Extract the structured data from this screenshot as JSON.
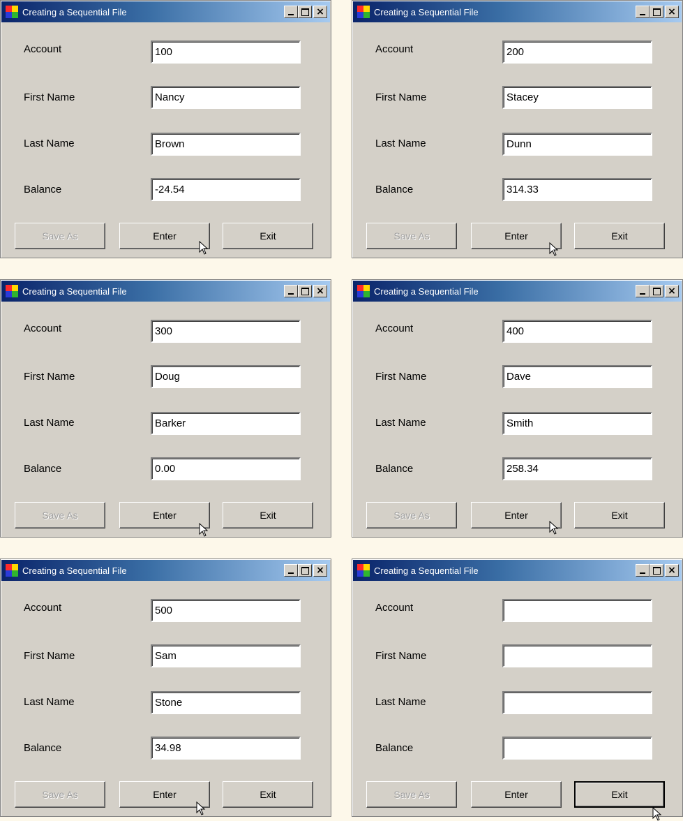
{
  "labels": {
    "account": "Account",
    "first_name": "First Name",
    "last_name": "Last Name",
    "balance": "Balance"
  },
  "buttons": {
    "save_as": "Save As",
    "enter": "Enter",
    "exit": "Exit"
  },
  "window_title": "Creating a Sequential File",
  "windows": [
    {
      "account": "100",
      "first_name": "Nancy",
      "last_name": "Brown",
      "balance": "-24.54"
    },
    {
      "account": "200",
      "first_name": "Stacey",
      "last_name": "Dunn",
      "balance": "314.33"
    },
    {
      "account": "300",
      "first_name": "Doug",
      "last_name": "Barker",
      "balance": "0.00"
    },
    {
      "account": "400",
      "first_name": "Dave",
      "last_name": "Smith",
      "balance": "258.34"
    },
    {
      "account": "500",
      "first_name": "Sam",
      "last_name": "Stone",
      "balance": "34.98"
    },
    {
      "account": "",
      "first_name": "",
      "last_name": "",
      "balance": ""
    }
  ],
  "colors": {
    "page_bg": "#fdf8ea",
    "window_bg": "#d4d0c8",
    "title_start": "#0a246a",
    "title_end": "#a6caf0"
  }
}
